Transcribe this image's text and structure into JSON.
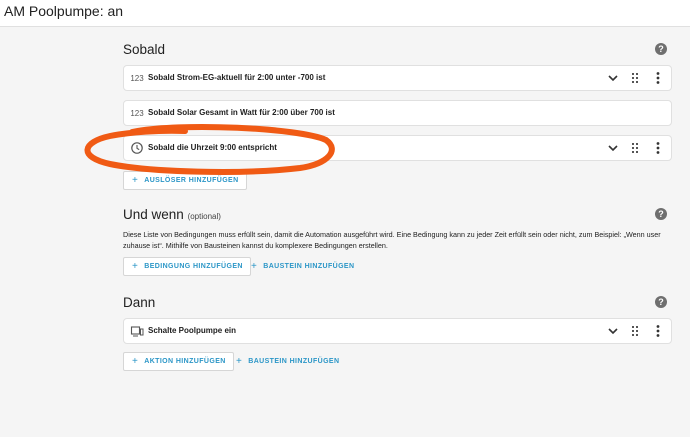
{
  "window": {
    "title": "AM Poolpumpe: an"
  },
  "triggers": {
    "title": "Sobald",
    "items": [
      {
        "icon": "number-icon",
        "icon_text": "123",
        "label": "Sobald Strom-EG-aktuell für 2:00 unter -700 ist"
      },
      {
        "icon": "number-icon",
        "icon_text": "123",
        "label": "Sobald Solar Gesamt in Watt für 2:00 über 700 ist"
      },
      {
        "icon": "clock-icon",
        "label": "Sobald die Uhrzeit 9:00 entspricht"
      }
    ],
    "add_label": "AUSLÖSER HINZUFÜGEN"
  },
  "conditions": {
    "title": "Und wenn",
    "optional": "(optional)",
    "description": "Diese Liste von Bedingungen muss erfüllt sein, damit die Automation ausgeführt wird. Eine Bedingung kann zu jeder Zeit erfüllt sein oder nicht, zum Beispiel: „Wenn user zuhause ist“. Mithilfe von Bausteinen kannst du komplexere Bedingungen erstellen.",
    "add_label": "BEDINGUNG HINZUFÜGEN",
    "block_label": "BAUSTEIN HINZUFÜGEN"
  },
  "actions": {
    "title": "Dann",
    "items": [
      {
        "icon": "device-icon",
        "label": "Schalte Poolpumpe ein"
      }
    ],
    "add_label": "AKTION HINZUFÜGEN",
    "block_label": "BAUSTEIN HINZUFÜGEN"
  },
  "help_glyph": "?",
  "plus_glyph": "+",
  "colors": {
    "accent": "#2b96c7",
    "annotation": "#f05a14",
    "background": "#f5f5f5"
  }
}
